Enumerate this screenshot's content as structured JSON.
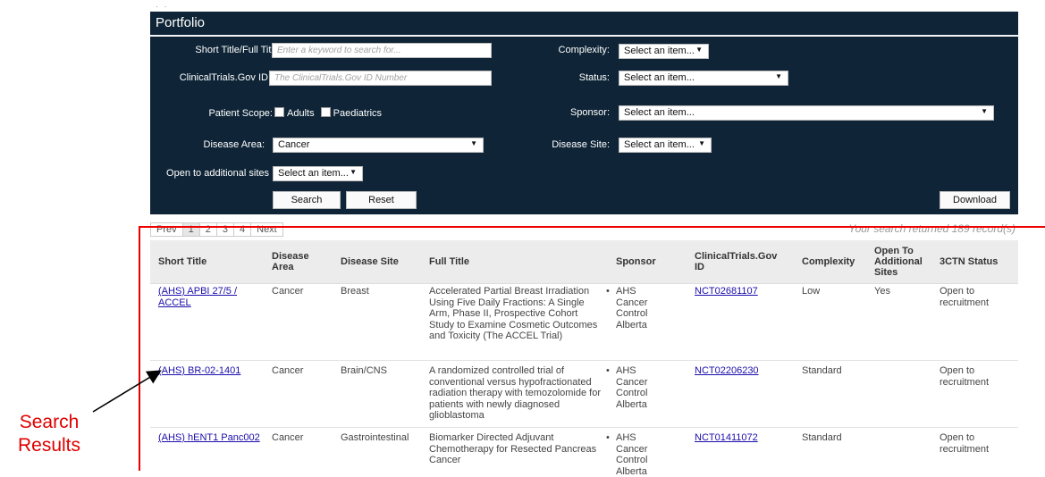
{
  "top_marker": "· ·",
  "panel": {
    "title": "Portfolio",
    "short_title_label": "Short Title/Full Title:",
    "short_title_placeholder": "Enter a keyword to search for...",
    "ctgov_label": "ClinicalTrials.Gov ID:",
    "ctgov_placeholder": "The ClinicalTrials.Gov ID Number",
    "patient_scope_label": "Patient Scope:",
    "scope_adults": "Adults",
    "scope_paediatrics": "Paediatrics",
    "disease_area_label": "Disease Area:",
    "disease_area_value": "Cancer",
    "open_sites_label": "Open to additional sites",
    "open_sites_value": "Select an item...",
    "complexity_label": "Complexity:",
    "complexity_value": "Select an item...",
    "status_label": "Status:",
    "status_value": "Select an item...",
    "sponsor_label": "Sponsor:",
    "sponsor_value": "Select an item...",
    "disease_site_label": "Disease Site:",
    "disease_site_value": "Select an item...",
    "search_button": "Search",
    "reset_button": "Reset",
    "download_button": "Download"
  },
  "pager": {
    "prev": "Prev",
    "pages": [
      "1",
      "2",
      "3",
      "4"
    ],
    "next": "Next"
  },
  "records_text": "Your search returned 189 record(s)",
  "table": {
    "headers": {
      "short_title": "Short Title",
      "disease_area": "Disease Area",
      "disease_site": "Disease Site",
      "full_title": "Full Title",
      "sponsor": "Sponsor",
      "ctgov_id": "ClinicalTrials.Gov ID",
      "complexity": "Complexity",
      "open_sites": "Open To Additional Sites",
      "status": "3CTN Status"
    },
    "rows": [
      {
        "short_title": "(AHS) APBI 27/5 / ACCEL",
        "disease_area": "Cancer",
        "disease_site": "Breast",
        "full_title": "Accelerated Partial Breast Irradiation Using Five Daily Fractions: A Single Arm, Phase II, Prospective Cohort Study to Examine Cosmetic Outcomes and Toxicity (The ACCEL Trial)",
        "sponsor": "AHS Cancer Control Alberta",
        "ctgov_id": "NCT02681107",
        "complexity": "Low",
        "open_sites": "Yes",
        "status": "Open to recruitment"
      },
      {
        "short_title": "(AHS) BR-02-1401",
        "disease_area": "Cancer",
        "disease_site": "Brain/CNS",
        "full_title": "A randomized controlled trial of conventional versus hypofractionated radiation therapy with temozolomide for patients with newly diagnosed glioblastoma",
        "sponsor": "AHS Cancer Control Alberta",
        "ctgov_id": "NCT02206230",
        "complexity": "Standard",
        "open_sites": "",
        "status": "Open to recruitment"
      },
      {
        "short_title": "(AHS) hENT1 Panc002",
        "disease_area": "Cancer",
        "disease_site": "Gastrointestinal",
        "full_title": "Biomarker Directed Adjuvant Chemotherapy for Resected Pancreas Cancer",
        "sponsor": "AHS Cancer Control Alberta",
        "ctgov_id": "NCT01411072",
        "complexity": "Standard",
        "open_sites": "",
        "status": "Open to recruitment"
      }
    ]
  },
  "annotation": {
    "line1": "Search",
    "line2": "Results",
    "color": "#ee0000"
  },
  "colors": {
    "panel_bg": "#0f2537",
    "link": "#1a0dab",
    "header_bg": "#ececec"
  }
}
